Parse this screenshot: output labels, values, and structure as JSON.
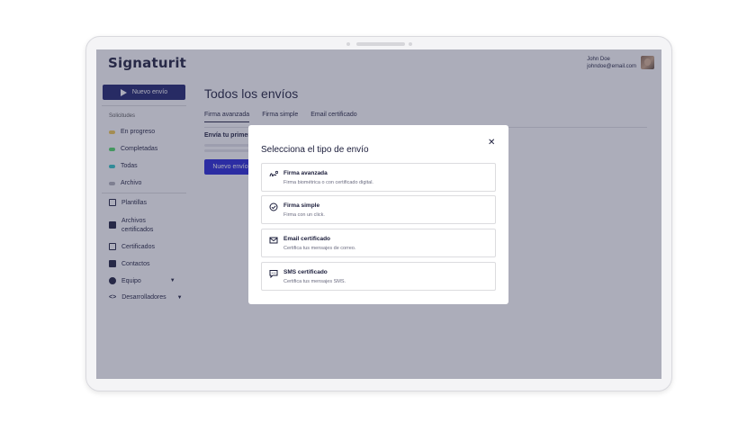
{
  "app": {
    "logo": "Signaturit"
  },
  "user": {
    "name": "John Doe",
    "email": "johndoe@email.com"
  },
  "sidebar": {
    "new_button": "Nuevo envío",
    "section_label": "Solicitudes",
    "status_items": [
      {
        "label": "En progreso",
        "color": "#f2c94c"
      },
      {
        "label": "Completadas",
        "color": "#4cd964"
      },
      {
        "label": "Todas",
        "color": "#2ec4c4"
      },
      {
        "label": "Archivo",
        "color": "#b0b0b8"
      }
    ],
    "nav_items": [
      {
        "label": "Plantillas",
        "icon": "template-icon"
      },
      {
        "label": "Archivos certificados",
        "icon": "file-icon"
      },
      {
        "label": "Certificados",
        "icon": "certificate-icon"
      },
      {
        "label": "Contactos",
        "icon": "contacts-icon"
      },
      {
        "label": "Equipo",
        "icon": "team-icon"
      },
      {
        "label": "Desarrolladores",
        "icon": "code-icon"
      }
    ]
  },
  "main": {
    "title": "Todos los envíos",
    "tabs": [
      "Firma avanzada",
      "Firma simple",
      "Email certificado"
    ],
    "subheading": "Envía tu primer",
    "button": "Nuevo envío"
  },
  "modal": {
    "title": "Selecciona el tipo de envío",
    "options": [
      {
        "title": "Firma avanzada",
        "desc": "Firma biométrica o con certificado digital.",
        "icon": "signature-icon"
      },
      {
        "title": "Firma simple",
        "desc": "Firma con un click.",
        "icon": "check-circle-icon"
      },
      {
        "title": "Email certificado",
        "desc": "Certifica tus mensajes de correo.",
        "icon": "mail-icon"
      },
      {
        "title": "SMS certificado",
        "desc": "Certifica tus mensajes SMS.",
        "icon": "sms-icon"
      }
    ]
  }
}
